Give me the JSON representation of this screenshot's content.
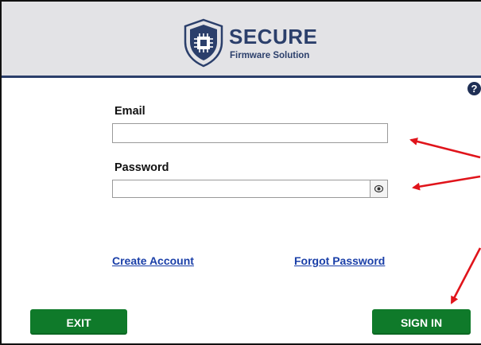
{
  "header": {
    "logo_title": "SECURE",
    "logo_subtitle": "Firmware Solution",
    "logo_icon": "shield-chip-icon",
    "brand_color": "#2b3f6b",
    "background": "#e3e3e6"
  },
  "help": {
    "icon": "question-circle-icon",
    "glyph": "?"
  },
  "form": {
    "email_label": "Email",
    "email_value": "",
    "password_label": "Password",
    "password_value": "",
    "show_password_icon": "eye-icon"
  },
  "links": {
    "create_account": "Create Account",
    "forgot_password": "Forgot Password",
    "color": "#1a3fa8"
  },
  "buttons": {
    "exit": "EXIT",
    "sign_in": "SIGN IN",
    "color": "#0f7a2a"
  },
  "annotations": {
    "arrow_color": "#e0141b",
    "arrow_count": 3
  }
}
